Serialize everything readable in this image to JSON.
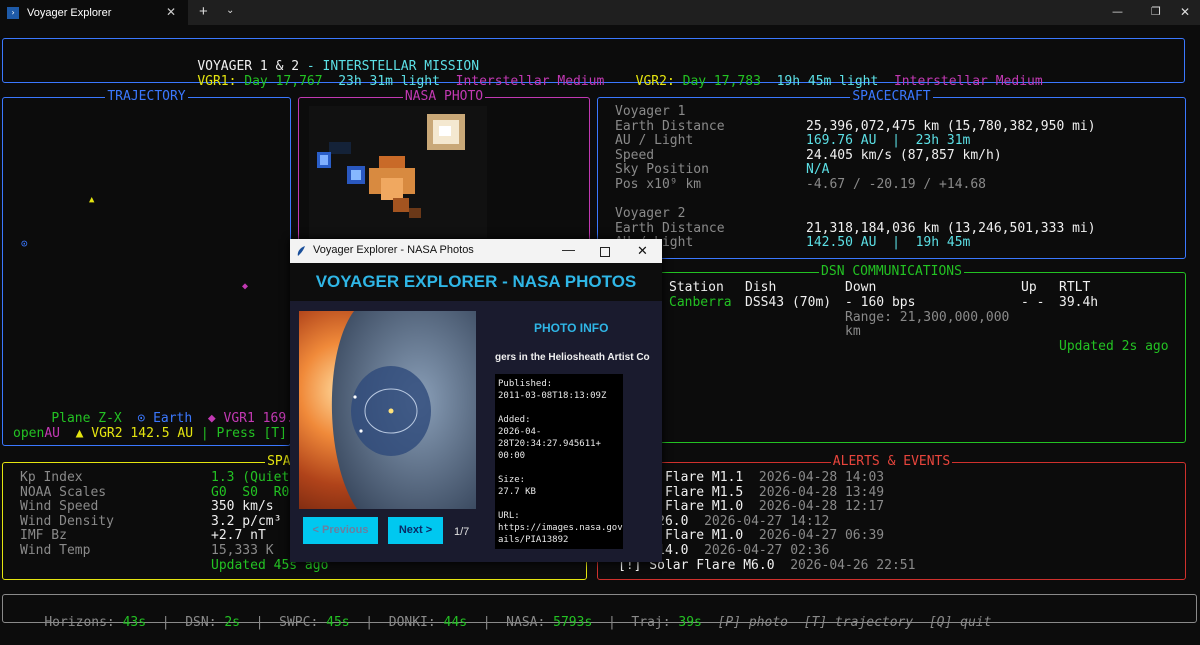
{
  "window": {
    "tab_title": "Voyager Explorer",
    "tab_icon": "terminal-icon",
    "new_tab": "+",
    "close_tab": "✕"
  },
  "header": {
    "title_a": "VOYAGER 1 & 2",
    "title_b": " - INTERSTELLAR MISSION",
    "vgr1_label": "VGR1:",
    "vgr1_day": "Day 17,767",
    "vgr1_light": "23h 31m light",
    "vgr1_region": "Interstellar Medium",
    "vgr2_label": "VGR2:",
    "vgr2_day": "Day 17,783",
    "vgr2_light": "19h 45m light",
    "vgr2_region": "Interstellar Medium"
  },
  "trajectory": {
    "title": "TRAJECTORY",
    "plane": "Plane Z-X",
    "earth_legend": "⊙ Earth",
    "vgr1_legend": "◆ VGR1 169.8",
    "au1": "AU",
    "vgr2_legend": "▲ VGR2 142.5 AU",
    "press": "| Press [T] to",
    "open": "open",
    "marker_earth": "⊙",
    "marker_vgr1": "◆",
    "marker_vgr2": "▲"
  },
  "nasa_photo": {
    "title": "NASA PHOTO"
  },
  "spacecraft": {
    "title": "SPACECRAFT",
    "v1": {
      "name": "Voyager 1",
      "labels": [
        "Earth Distance",
        "AU / Light",
        "Speed",
        "Sky Position",
        "Pos x10⁹ km"
      ],
      "distance": "25,396,072,475 km (15,780,382,950 mi)",
      "au_light": "169.76 AU  |  23h 31m",
      "speed": "24.405 km/s (87,857 km/h)",
      "sky": "N/A",
      "pos": "-4.67 / -20.19 / +14.68"
    },
    "v2": {
      "name": "Voyager 2",
      "label_distance": "Earth Distance",
      "label_light": "AU / Light",
      "distance": "21,318,184,036 km (13,246,501,333 mi)",
      "au_light": "142.50 AU  |  19h 45m"
    }
  },
  "dsn": {
    "title": "DSN COMMUNICATIONS",
    "headers": {
      "station": "Station",
      "dish": "Dish",
      "down": "Down",
      "up": "Up",
      "rtlt": "RTLT"
    },
    "row": {
      "station": "Canberra",
      "dish": "DSS43 (70m)",
      "down": "- 160 bps",
      "up": "- -",
      "rtlt": "39.4h"
    },
    "range_1": "Range: 21,300,000,000",
    "range_2": "km",
    "updated": "Updated 2s ago"
  },
  "space_weather": {
    "title": "SPACE W",
    "labels": [
      "Kp Index",
      "NOAA Scales",
      "Wind Speed",
      "Wind Density",
      "IMF Bz",
      "Wind Temp"
    ],
    "kp": "1.3 (Quiet)",
    "scales": "G0  S0  R0",
    "speed": "350 km/s",
    "density": "3.2 p/cm³",
    "imf": "+2.7 nT",
    "temp": "15,333 K",
    "updated": "Updated 45s ago"
  },
  "alerts": {
    "title": "ALERTS & EVENTS",
    "events": [
      {
        "name": "Solar Flare M1.1",
        "time": "2026-04-28 14:03"
      },
      {
        "name": "Solar Flare M1.5",
        "time": "2026-04-28 13:49"
      },
      {
        "name": "Solar Flare M1.0",
        "time": "2026-04-28 12:17"
      },
      {
        "name": "E HA=26.0",
        "time": "2026-04-27 14:12"
      },
      {
        "name": "Solar Flare M1.0",
        "time": "2026-04-27 06:39"
      },
      {
        "name": "E HA=14.0",
        "time": "2026-04-27 02:36"
      },
      {
        "name": "[!] Solar Flare M6.0",
        "time": "2026-04-26 22:51"
      }
    ]
  },
  "statusbar": {
    "horizons_label": "Horizons:",
    "horizons": "43s",
    "dsn_label": "DSN:",
    "dsn": "2s",
    "swpc_label": "SWPC:",
    "swpc": "45s",
    "donki_label": "DONKI:",
    "donki": "44s",
    "nasa_label": "NASA:",
    "nasa": "5793s",
    "traj_label": "Traj:",
    "traj": "39s",
    "keys": "[P] photo  [T] trajectory  [Q] quit"
  },
  "photo_dialog": {
    "window_title": "Voyager Explorer - NASA Photos",
    "header": "VOYAGER EXPLORER - NASA PHOTOS",
    "info_title": "PHOTO INFO",
    "photo_title": "gers in the Heliosheath Artist Co",
    "meta": "Published:\n2011-03-08T18:13:09Z\n\nAdded:\n2026-04-28T20:34:27.945611+\n00:00\n\nSize:\n27.7 KB\n\nURL:\nhttps://images.nasa.gov/det\nails/PIA13892",
    "prev": "< Previous",
    "next": "Next >",
    "counter": "1/7"
  },
  "colors": {
    "cyan": "#5ce0e6",
    "green": "#23c223",
    "magenta": "#c239b3",
    "yellow": "#e5e510",
    "blue": "#3b78ff",
    "red": "#d0312d"
  }
}
